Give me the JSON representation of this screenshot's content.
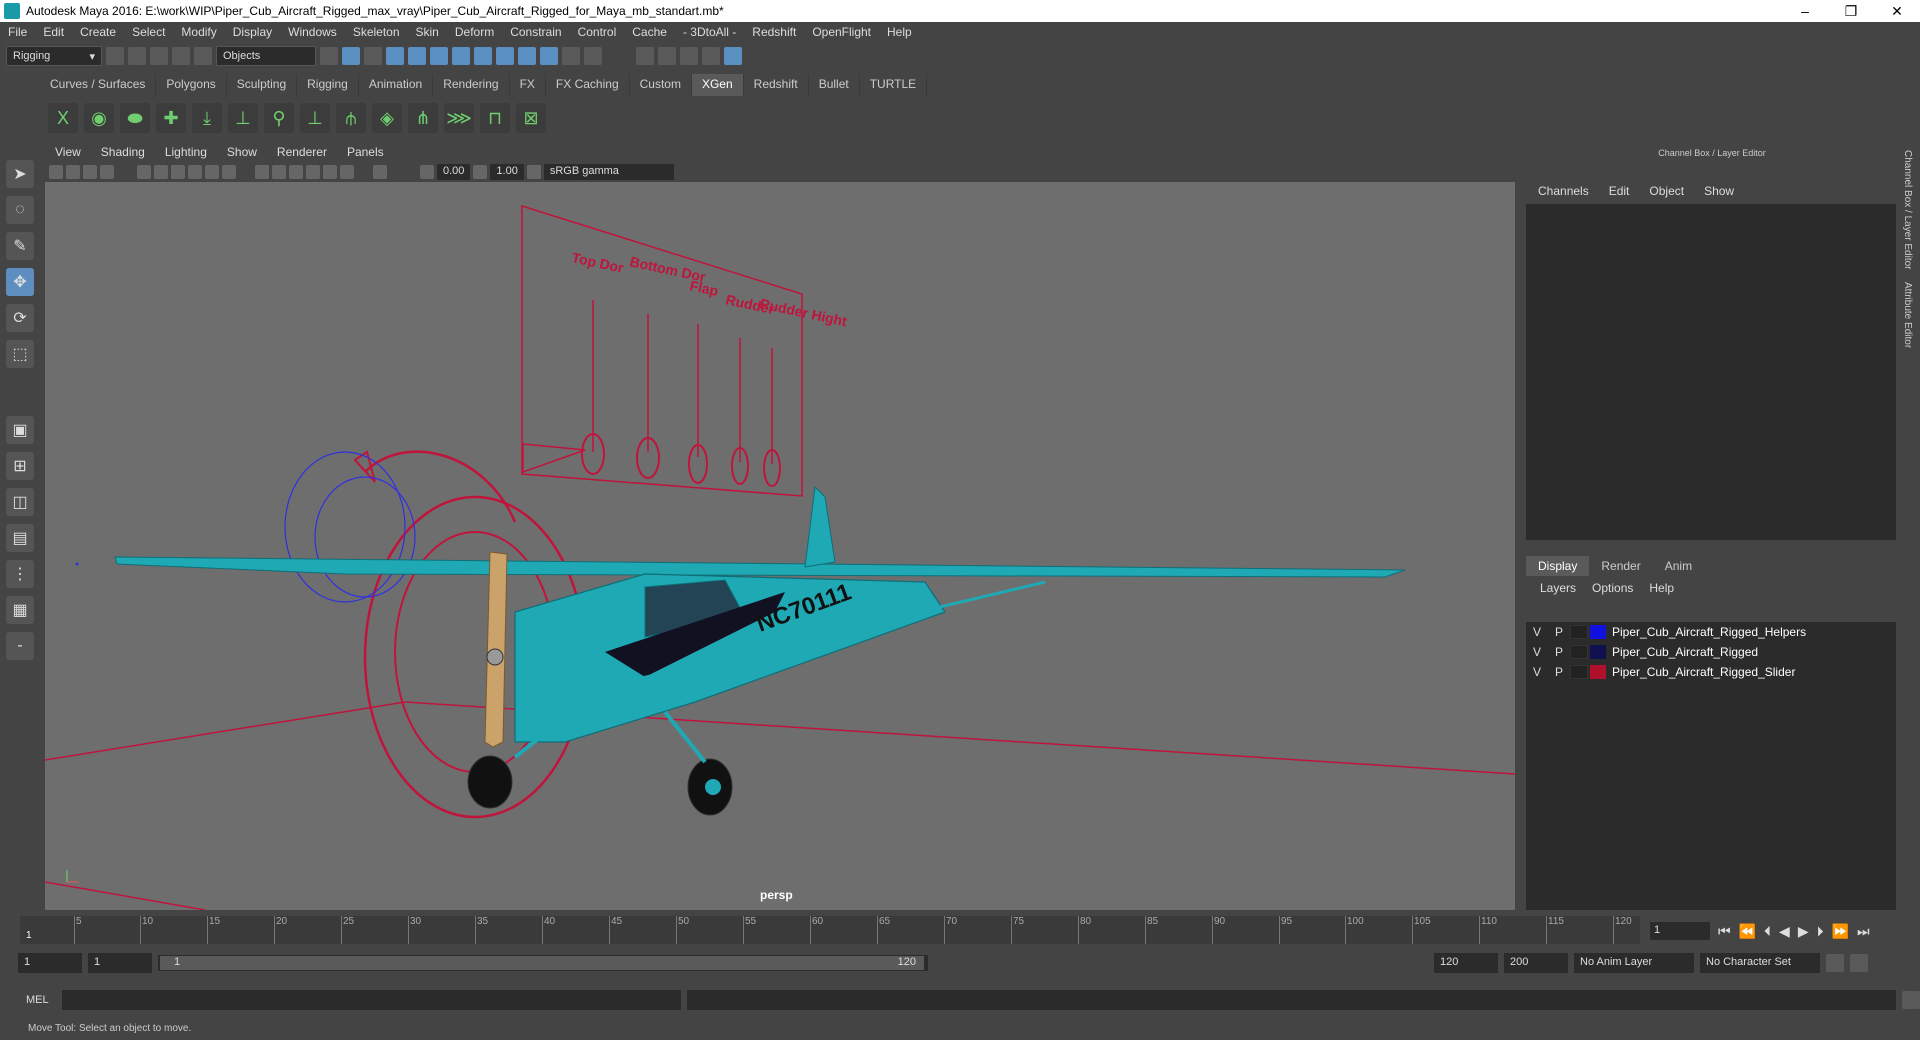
{
  "titlebar": {
    "title": "Autodesk Maya 2016: E:\\work\\WIP\\Piper_Cub_Aircraft_Rigged_max_vray\\Piper_Cub_Aircraft_Rigged_for_Maya_mb_standart.mb*"
  },
  "menubar": [
    "File",
    "Edit",
    "Create",
    "Select",
    "Modify",
    "Display",
    "Windows",
    "Skeleton",
    "Skin",
    "Deform",
    "Constrain",
    "Control",
    "Cache",
    "- 3DtoAll -",
    "Redshift",
    "OpenFlight",
    "Help"
  ],
  "statusline": {
    "mode": "Rigging",
    "selection_mask": "Objects"
  },
  "shelf_tabs": [
    "Curves / Surfaces",
    "Polygons",
    "Sculpting",
    "Rigging",
    "Animation",
    "Rendering",
    "FX",
    "FX Caching",
    "Custom",
    "XGen",
    "Redshift",
    "Bullet",
    "TURTLE"
  ],
  "shelf_active": "XGen",
  "viewport": {
    "menu": [
      "View",
      "Shading",
      "Lighting",
      "Show",
      "Renderer",
      "Panels"
    ],
    "exposure": "0.00",
    "gamma": "1.00",
    "color_space": "sRGB gamma",
    "camera": "persp",
    "slider_labels": [
      "Top Dor",
      "Bottom Dor",
      "Flap",
      "Rudder",
      "Rudder Hight"
    ],
    "aircraft_registration": "NC70111"
  },
  "channelbox": {
    "title": "Channel Box / Layer Editor",
    "menu": [
      "Channels",
      "Edit",
      "Object",
      "Show"
    ],
    "tabs": [
      "Display",
      "Render",
      "Anim"
    ],
    "active_tab": "Display",
    "layer_menu": [
      "Layers",
      "Options",
      "Help"
    ],
    "layers": [
      {
        "v": "V",
        "p": "P",
        "name": "Piper_Cub_Aircraft_Rigged_Helpers",
        "color": "#1010e0"
      },
      {
        "v": "V",
        "p": "P",
        "name": "Piper_Cub_Aircraft_Rigged",
        "color": "#101050"
      },
      {
        "v": "V",
        "p": "P",
        "name": "Piper_Cub_Aircraft_Rigged_Slider",
        "color": "#b0102a"
      }
    ],
    "side_tabs": [
      "Channel Box / Layer Editor",
      "Attribute Editor"
    ]
  },
  "timeline": {
    "ticks": [
      "5",
      "10",
      "15",
      "20",
      "25",
      "30",
      "35",
      "40",
      "45",
      "50",
      "55",
      "60",
      "65",
      "70",
      "75",
      "80",
      "85",
      "90",
      "95",
      "100",
      "105",
      "110",
      "115",
      "120"
    ],
    "start_label": "1",
    "current_frame": "1"
  },
  "range": {
    "start": "1",
    "playback_start": "1",
    "slider_left": "1",
    "slider_right": "120",
    "playback_end": "120",
    "end": "200",
    "anim_layer": "No Anim Layer",
    "character_set": "No Character Set"
  },
  "mel": {
    "label": "MEL"
  },
  "helpline": {
    "text": "Move Tool: Select an object to move."
  },
  "colors": {
    "accent": "#1a9aa8",
    "rig_red": "#c0143c",
    "rig_blue": "#3030e0"
  }
}
